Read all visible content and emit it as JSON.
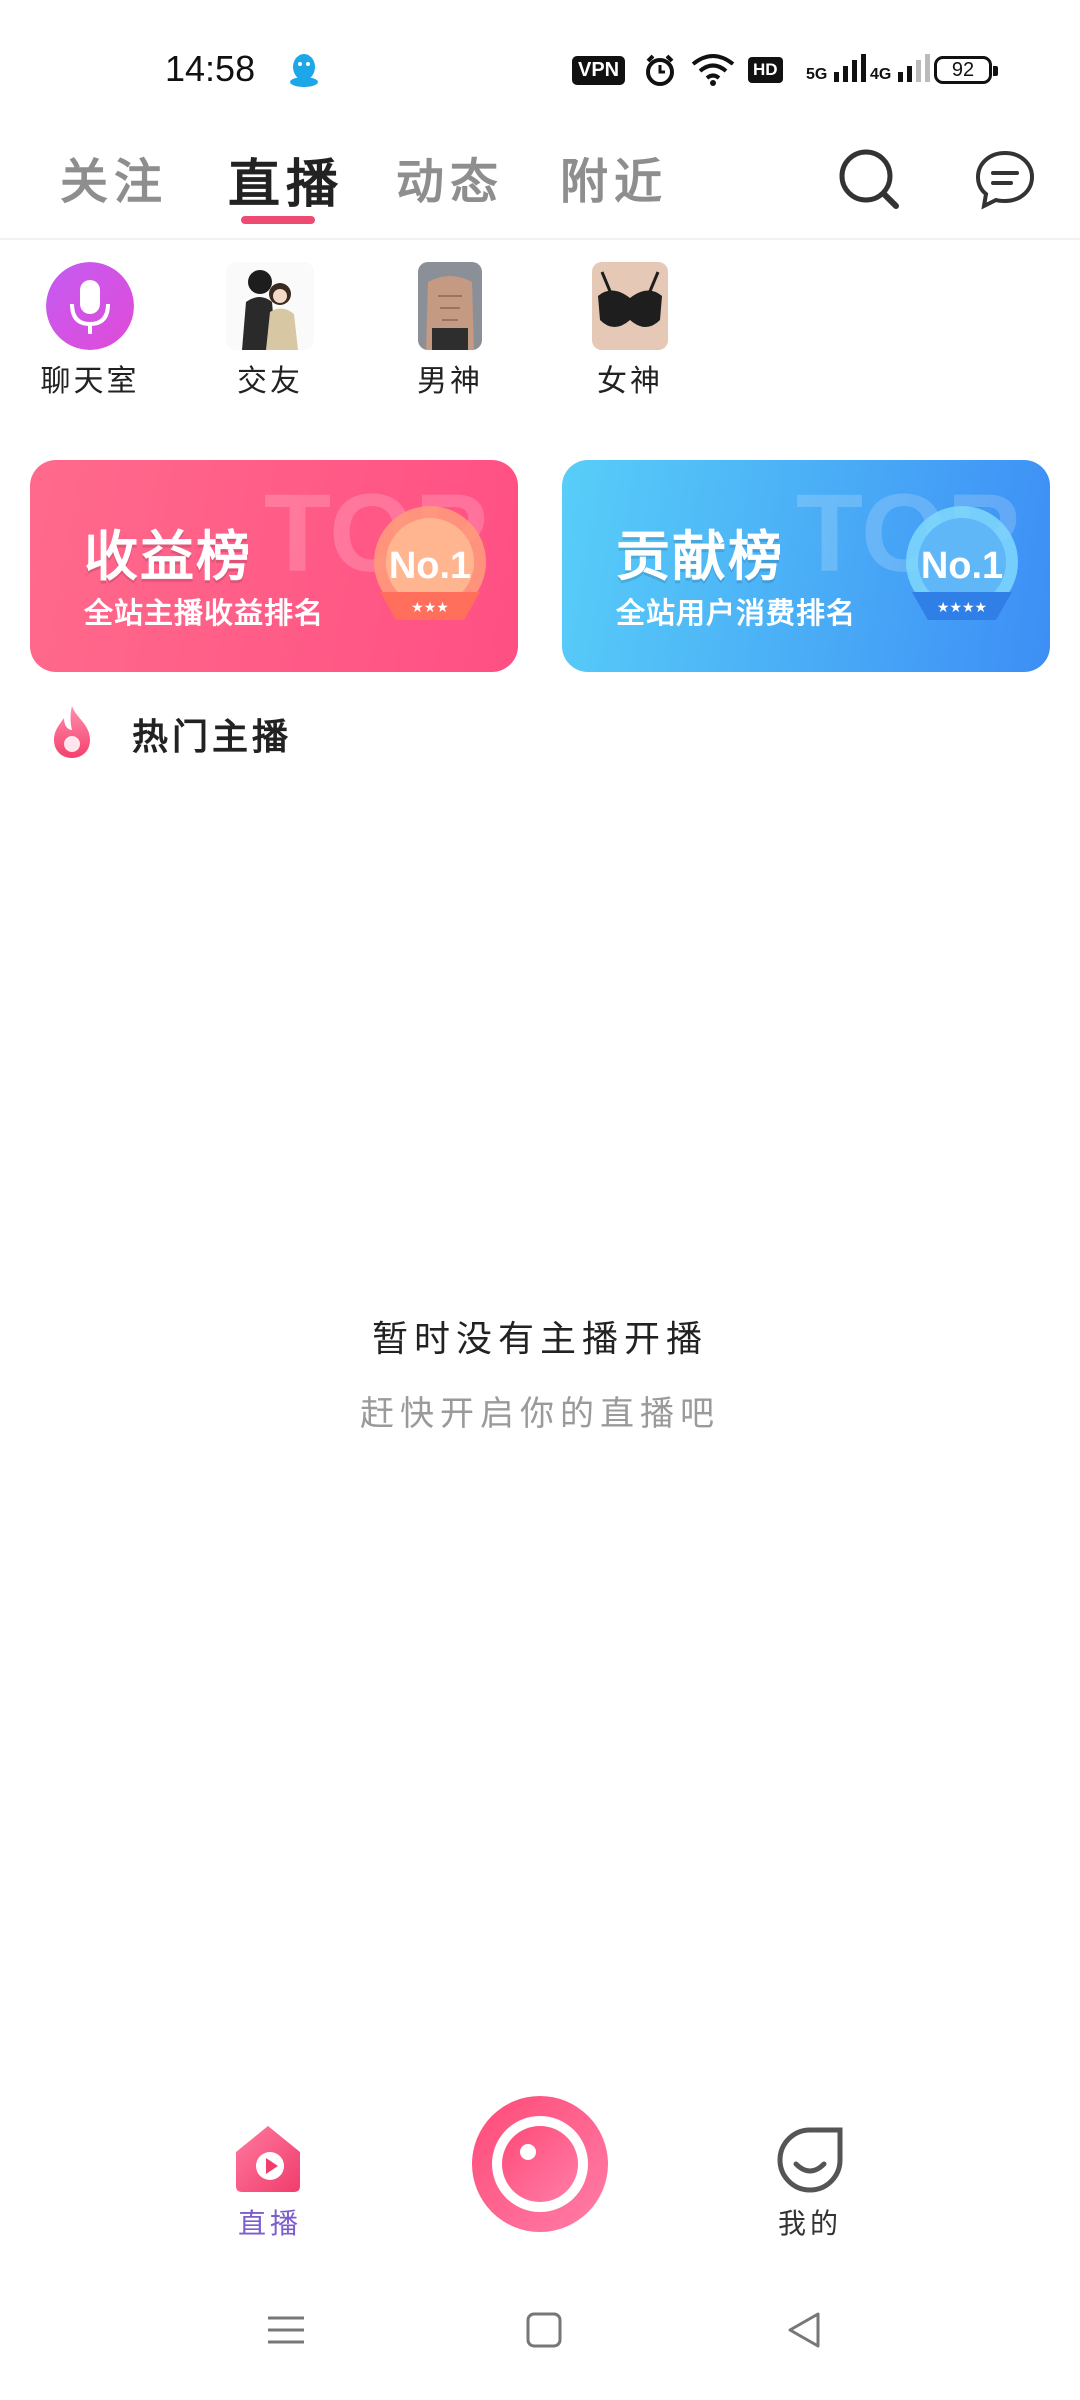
{
  "status_bar": {
    "time": "14:58",
    "vpn": "VPN",
    "hd": "HD",
    "net_5g": "5G",
    "net_4g": "4G",
    "battery": "92"
  },
  "top_tabs": [
    {
      "label": "关注",
      "active": false
    },
    {
      "label": "直播",
      "active": true
    },
    {
      "label": "动态",
      "active": false
    },
    {
      "label": "附近",
      "active": false
    }
  ],
  "categories": [
    {
      "label": "聊天室",
      "icon": "microphone-icon"
    },
    {
      "label": "交友",
      "icon": "couple-image"
    },
    {
      "label": "男神",
      "icon": "male-image"
    },
    {
      "label": "女神",
      "icon": "female-image"
    }
  ],
  "banners": [
    {
      "title": "收益榜",
      "subtitle": "全站主播收益排名",
      "bg_text": "TOP",
      "badge": "No.1",
      "color": "#ff5a86"
    },
    {
      "title": "贡献榜",
      "subtitle": "全站用户消费排名",
      "bg_text": "TOP",
      "badge": "No.1",
      "color": "#4aa8f7"
    }
  ],
  "hot_section": {
    "title": "热门主播"
  },
  "empty_state": {
    "title": "暂时没有主播开播",
    "subtitle": "赶快开启你的直播吧"
  },
  "bottom_nav": [
    {
      "label": "直播",
      "active": true,
      "icon": "live-home-icon"
    },
    {
      "label": "",
      "icon": "camera-start-live-icon"
    },
    {
      "label": "我的",
      "active": false,
      "icon": "profile-smile-icon"
    }
  ],
  "accent_color": "#ee4b72"
}
